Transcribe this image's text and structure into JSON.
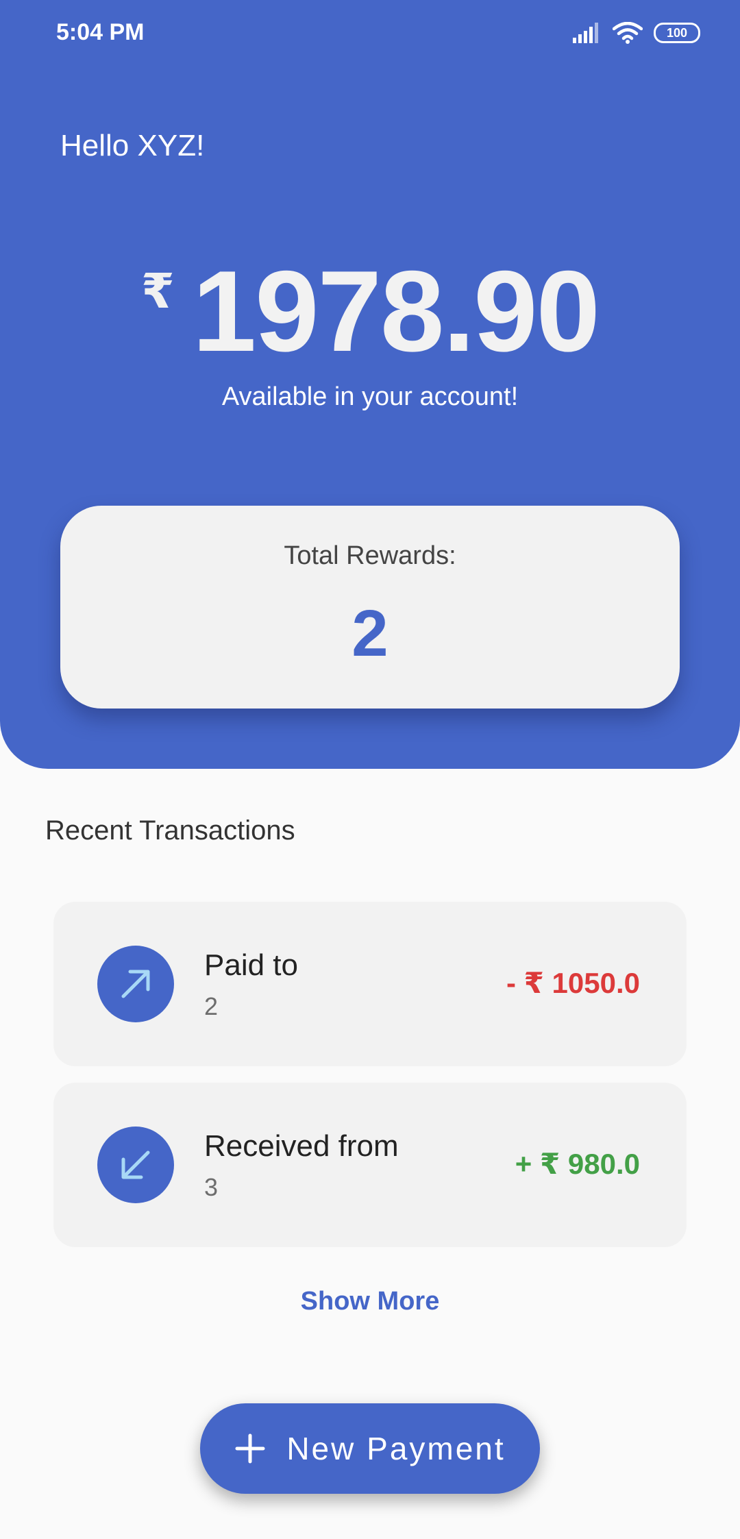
{
  "status_bar": {
    "time": "5:04 PM",
    "battery": "100",
    "icons": [
      "signal-icon",
      "wifi-icon",
      "battery-icon"
    ]
  },
  "header": {
    "greeting": "Hello XYZ!",
    "currency_symbol": "₹",
    "balance": "1978.90",
    "balance_caption": "Available in your account!"
  },
  "rewards": {
    "label": "Total Rewards:",
    "value": "2"
  },
  "transactions": {
    "title": "Recent Transactions",
    "items": [
      {
        "icon": "arrow-up-right-icon",
        "title": "Paid to",
        "subtitle": "2",
        "amount": "- ₹ 1050.0",
        "type": "debit"
      },
      {
        "icon": "arrow-down-left-icon",
        "title": "Received from",
        "subtitle": "3",
        "amount": "+ ₹ 980.0",
        "type": "credit"
      }
    ],
    "show_more_label": "Show More"
  },
  "fab": {
    "icon": "plus-icon",
    "label": "New Payment"
  },
  "colors": {
    "primary": "#4566c8",
    "debit": "#dc3a3a",
    "credit": "#43a047",
    "card": "#f2f2f2",
    "background": "#fafafa"
  }
}
